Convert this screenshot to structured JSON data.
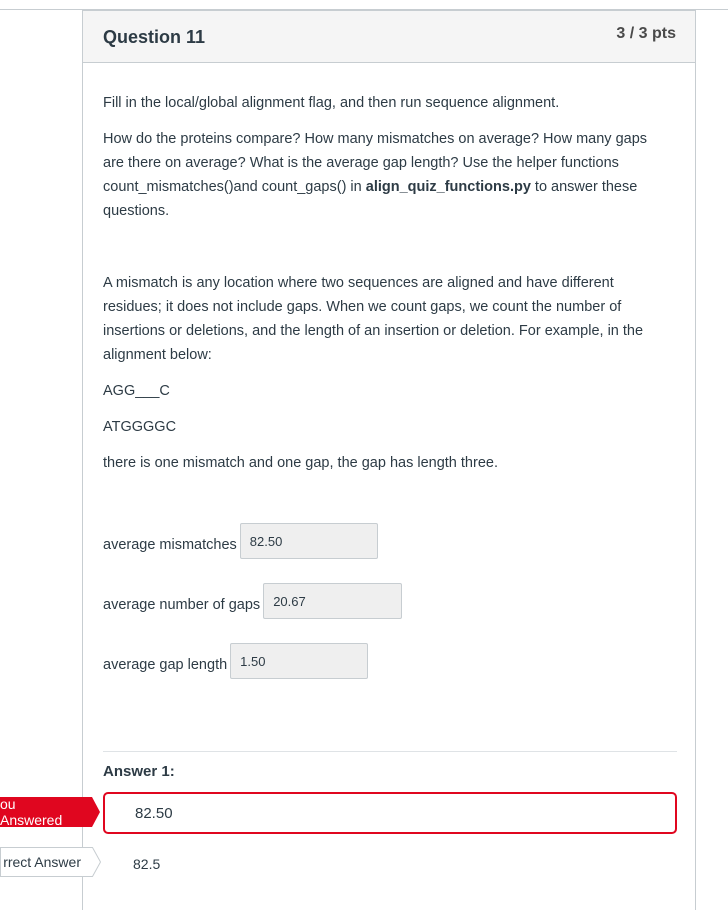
{
  "header": {
    "title": "Question 11",
    "points": "3 / 3 pts"
  },
  "question": {
    "p1": "Fill in the local/global alignment flag, and then run sequence alignment.",
    "p2_before": "How do the proteins compare? How many mismatches on average? How many gaps are there on average? What is the average gap length? Use the helper functions count_mismatches()and count_gaps() in ",
    "p2_bold": "align_quiz_functions.py",
    "p2_after": " to answer these questions.",
    "p3": "A mismatch is any location where two sequences are aligned and have different residues; it does not include gaps. When we count gaps, we count the number of insertions or deletions, and the length of an insertion or deletion. For example, in the alignment below:",
    "seq1": "AGG___C",
    "seq2": "ATGGGGC",
    "p4": "there is one mismatch and one gap, the gap has length three."
  },
  "fields": [
    {
      "label": "average mismatches",
      "value": "82.50"
    },
    {
      "label": "average number of gaps",
      "value": "20.67"
    },
    {
      "label": "average gap length",
      "value": "1.50"
    }
  ],
  "answer1": {
    "title": "Answer 1:",
    "you_answered_label": "ou Answered",
    "you_answered_value": "82.50",
    "correct_label": "rrect Answer",
    "correct_value": "82.5"
  },
  "colors": {
    "accent_red": "#e0061f",
    "text": "#2d3b45",
    "border": "#c7cdd1"
  }
}
